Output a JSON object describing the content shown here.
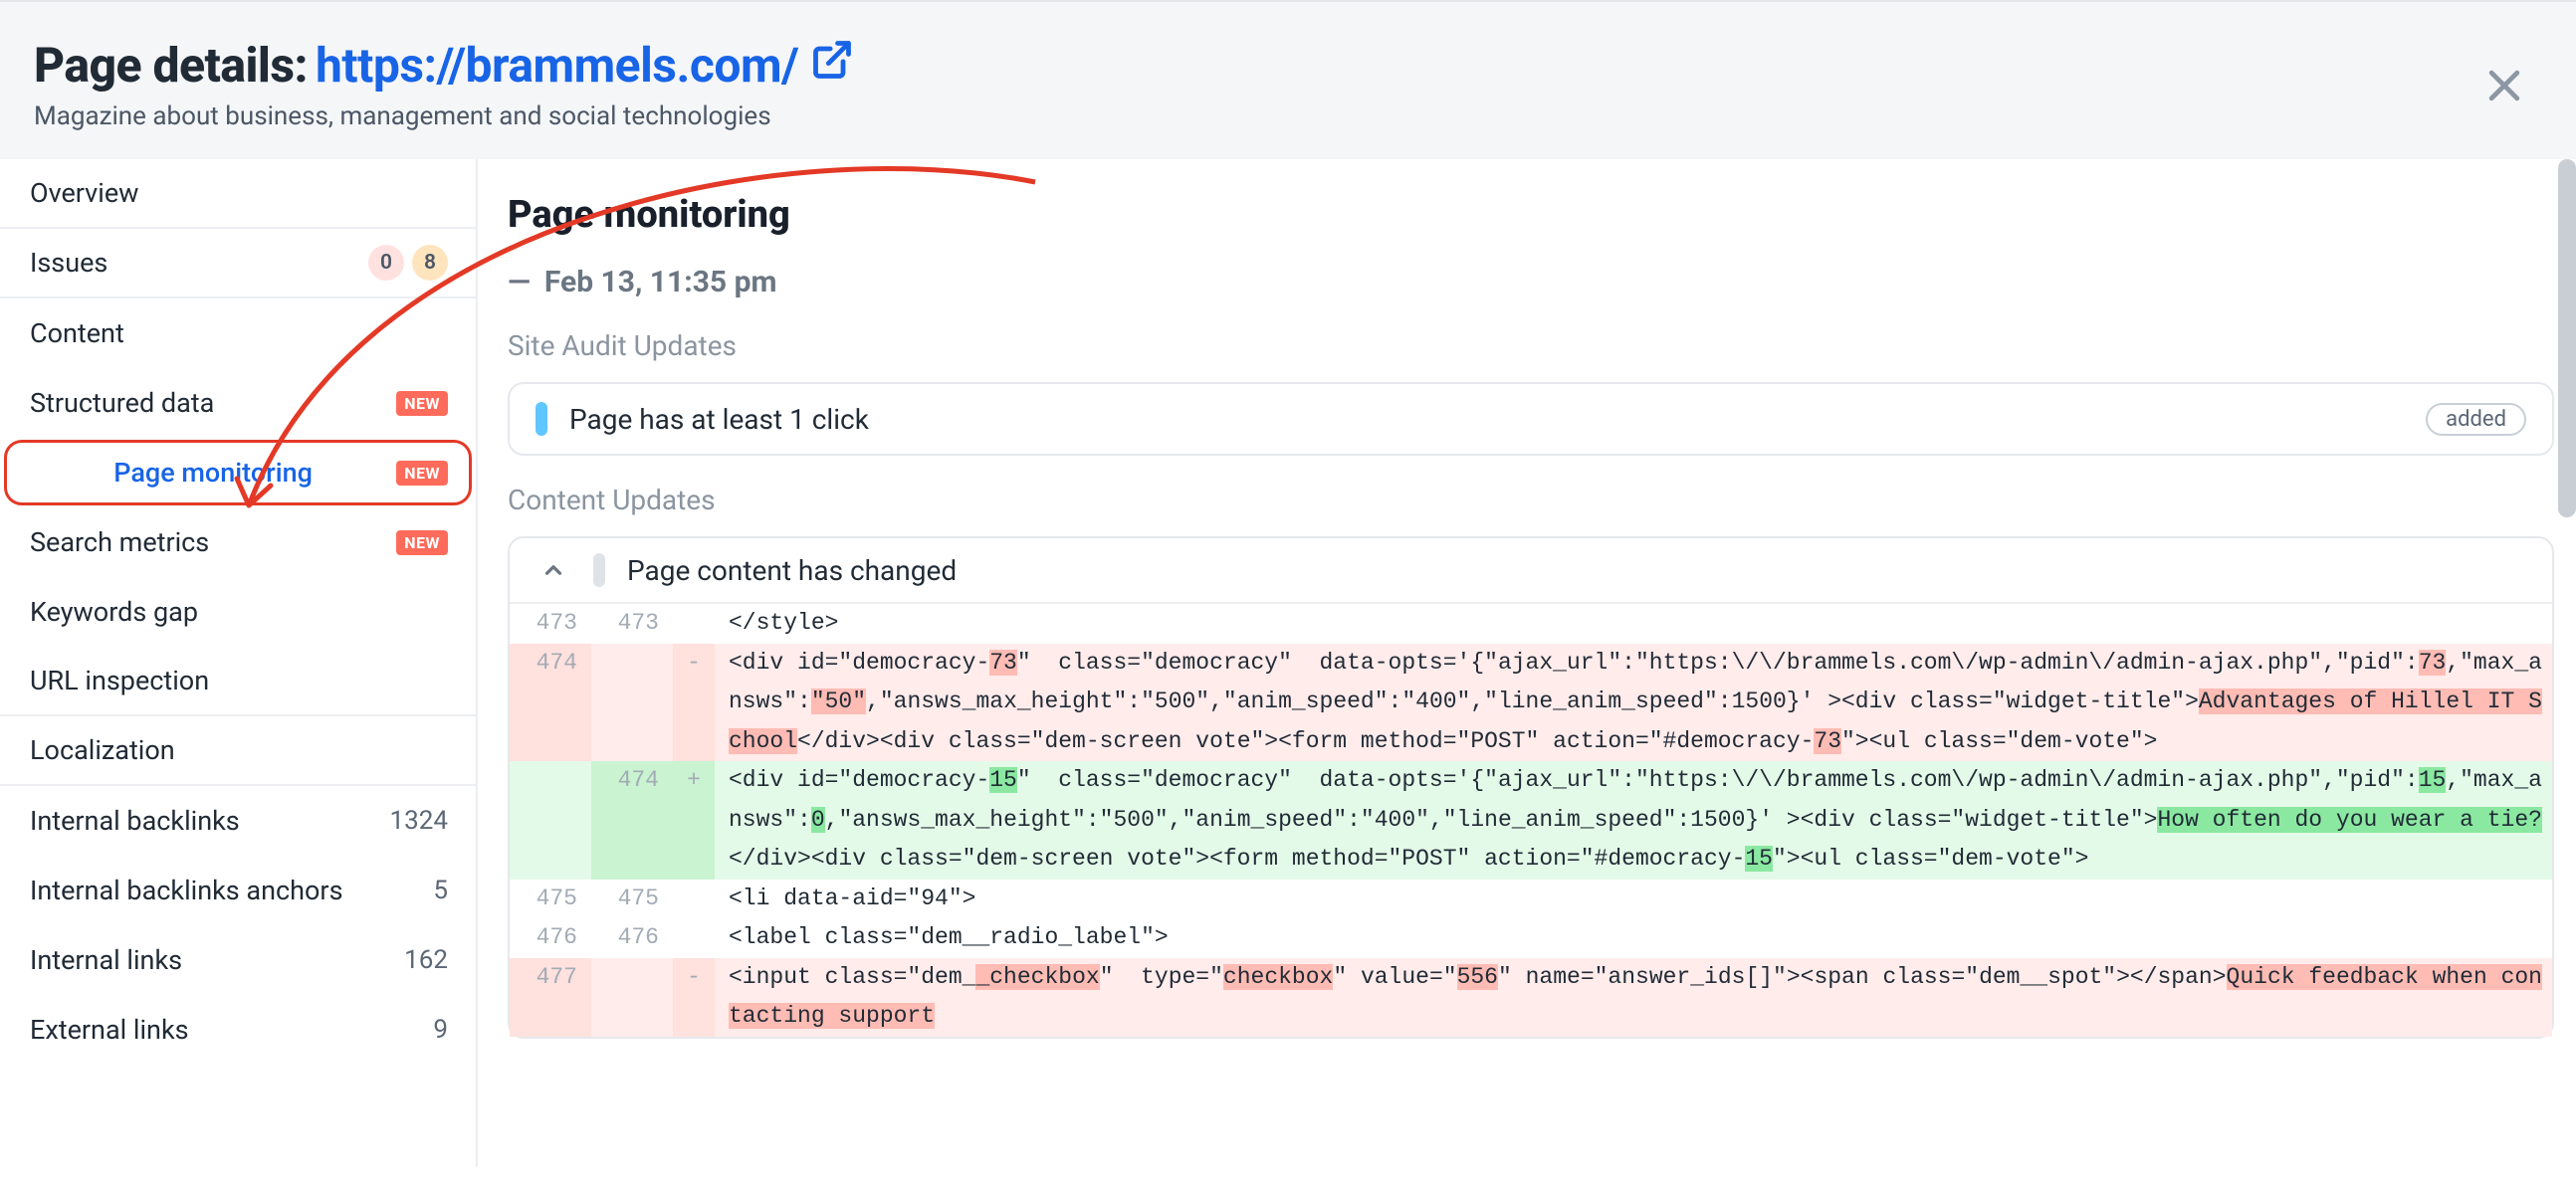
{
  "header": {
    "title_prefix": "Page details: ",
    "url": "https://brammels.com/",
    "subtitle": "Magazine about business, management and social technologies"
  },
  "sidebar": {
    "overview": "Overview",
    "issues": {
      "label": "Issues",
      "pink": "0",
      "orange": "8"
    },
    "content": "Content",
    "structured": {
      "label": "Structured data",
      "badge": "NEW"
    },
    "monitoring": {
      "label": "Page monitoring",
      "badge": "NEW"
    },
    "search_metrics": {
      "label": "Search metrics",
      "badge": "NEW"
    },
    "keywords_gap": "Keywords gap",
    "url_inspection": "URL inspection",
    "localization": "Localization",
    "int_backlinks": {
      "label": "Internal backlinks",
      "count": "1324"
    },
    "int_backlinks_anchors": {
      "label": "Internal backlinks anchors",
      "count": "5"
    },
    "int_links": {
      "label": "Internal links",
      "count": "162"
    },
    "ext_links": {
      "label": "External links",
      "count": "9"
    }
  },
  "main": {
    "title": "Page monitoring",
    "date": "Feb 13, 11:35 pm",
    "site_audit_label": "Site Audit Updates",
    "audit_item": {
      "text": "Page has at least 1 click",
      "badge": "added"
    },
    "content_updates_label": "Content Updates",
    "content_header": "Page content has changed"
  },
  "diff": {
    "r1": {
      "a": "473",
      "b": "473",
      "code": "</style>"
    },
    "del": {
      "a": "474",
      "sign": "-",
      "p1": "<div id=\"democracy-",
      "h1": "73",
      "p2": "\"  class=\"democracy\"  data-opts='{\"ajax_url\":\"https:\\/\\/brammels.com\\/wp-admin\\/admin-ajax.php\",\"pid\":",
      "h2": "73",
      "p3": ",\"max_answs\":",
      "h3": "\"50\"",
      "p4": ",\"answs_max_height\":\"500\",\"anim_speed\":\"400\",\"line_anim_speed\":1500}' ><div class=\"widget-title\">",
      "h4": "Advantages of Hillel IT School",
      "p5": "</div><div class=\"dem-screen vote\"><form method=\"POST\" action=\"#democracy-",
      "h5": "73",
      "p6": "\"><ul class=\"dem-vote\">"
    },
    "add": {
      "b": "474",
      "sign": "+",
      "p1": "<div id=\"democracy-",
      "h1": "15",
      "p2": "\"  class=\"democracy\"  data-opts='{\"ajax_url\":\"https:\\/\\/brammels.com\\/wp-admin\\/admin-ajax.php\",\"pid\":",
      "h2": "15",
      "p3": ",\"max_answs\":",
      "h3": "0",
      "p4": ",\"answs_max_height\":\"500\",\"anim_speed\":\"400\",\"line_anim_speed\":1500}' ><div class=\"widget-title\">",
      "h4": "How often do you wear a tie?",
      "p5": "</div><div class=\"dem-screen vote\"><form method=\"POST\" action=\"#democracy-",
      "h5": "15",
      "p6": "\"><ul class=\"dem-vote\">"
    },
    "r475": {
      "a": "475",
      "b": "475",
      "code": "<li data-aid=\"94\">"
    },
    "r476": {
      "a": "476",
      "b": "476",
      "code": "<label class=\"dem__radio_label\">"
    },
    "r477": {
      "a": "477",
      "sign": "-",
      "p1": "<input class=\"dem_",
      "h1": "_checkbox",
      "p2": "\"  type=\"",
      "h2": "checkbox",
      "p3": "\" value=\"",
      "h3": "556",
      "p4": "\" name=\"answer_ids[]\"><span class=\"dem__spot\"></span>",
      "h4": "Quick feedback when contacting support"
    }
  }
}
